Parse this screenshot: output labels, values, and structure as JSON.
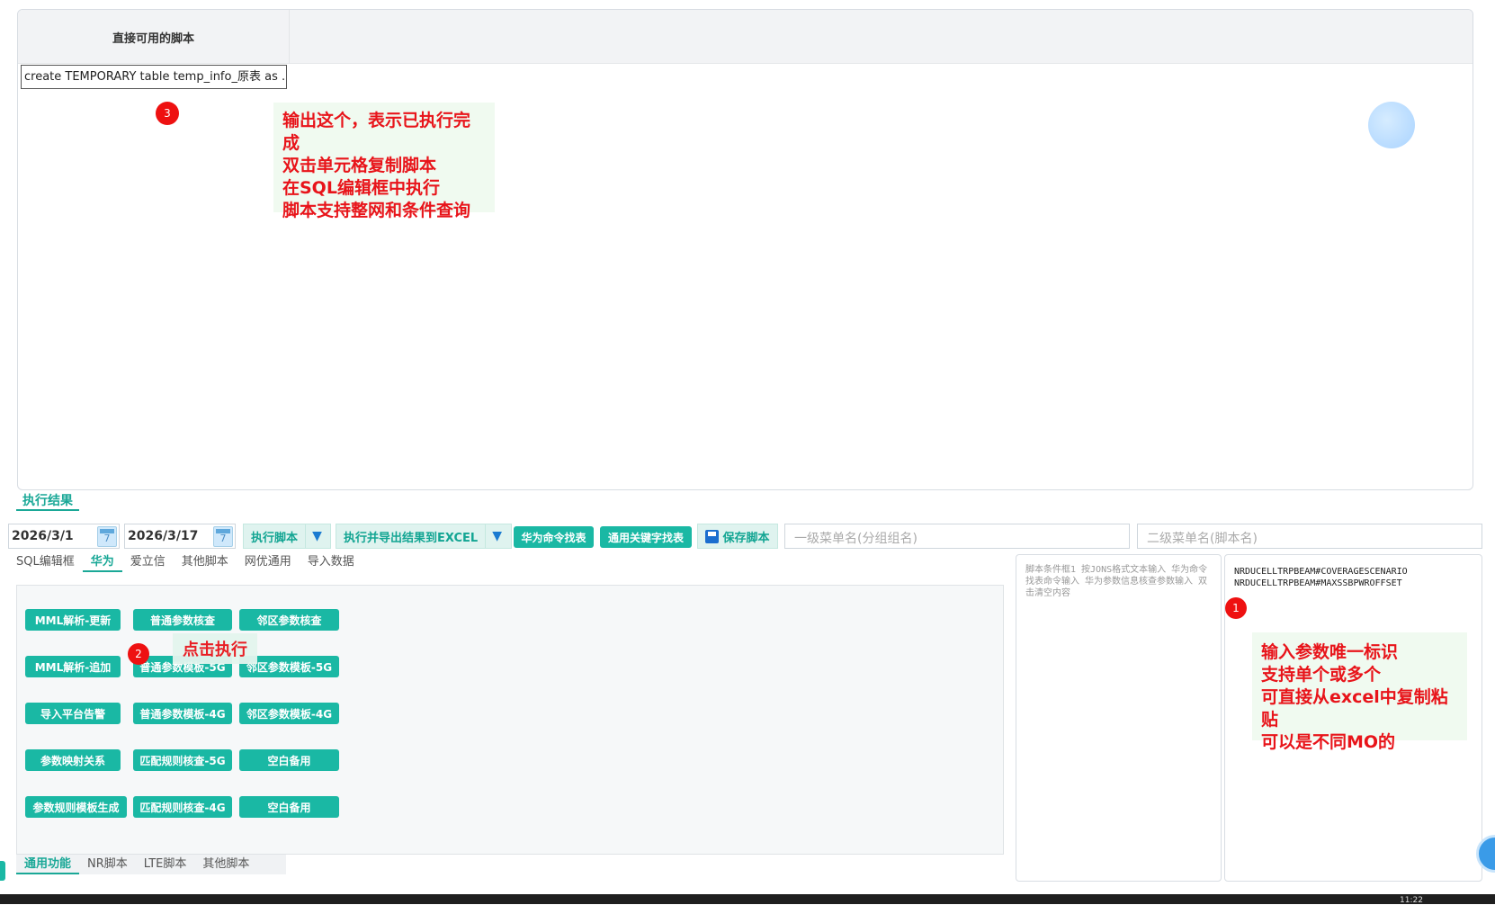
{
  "result_grid": {
    "column_header": "直接可用的脚本",
    "cell_value": "create TEMPORARY table temp_info_原表 as  ..."
  },
  "badges": {
    "one": "1",
    "two": "2",
    "three": "3"
  },
  "note_top": {
    "lines": [
      "输出这个，表示已执行完成",
      "双击单元格复制脚本",
      "在SQL编辑框中执行",
      "脚本支持整网和条件查询"
    ]
  },
  "result_tab": "执行结果",
  "toolbar": {
    "date_start": "2026/3/1",
    "date_end": "2026/3/17",
    "calendar_day": "7",
    "run_script": "执行脚本",
    "run_export": "执行并导出结果到EXCEL",
    "hw_cmd_find": "华为命令找表",
    "kw_find": "通用关键字找表",
    "save_script": "保存脚本",
    "menu1_placeholder": "一级菜单名(分组组名)",
    "menu2_placeholder": "二级菜单名(脚本名)"
  },
  "main_tabs": [
    "SQL编辑框",
    "华为",
    "爱立信",
    "其他脚本",
    "网优通用",
    "导入数据"
  ],
  "active_main_tab": "华为",
  "buttons": {
    "col1": [
      "MML解析-更新",
      "MML解析-追加",
      "导入平台告警",
      "参数映射关系",
      "参数规则模板生成"
    ],
    "col2": [
      "普通参数核查",
      "普通参数模板-5G",
      "普通参数模板-4G",
      "匹配规则核查-5G",
      "匹配规则核查-4G"
    ],
    "col3": [
      "邻区参数核查",
      "邻区参数模板-5G",
      "邻区参数模板-4G",
      "空白备用",
      "空白备用"
    ]
  },
  "note_click": "点击执行",
  "bottom_tabs": [
    "通用功能",
    "NR脚本",
    "LTE脚本",
    "其他脚本"
  ],
  "active_bottom_tab": "通用功能",
  "condition_box": {
    "placeholder": "脚本条件框1  按JONS格式文本输入  华为命令找表命令输入 华为参数信息核查参数输入  双击清空内容"
  },
  "param_box": {
    "lines": [
      "NRDUCELLTRPBEAM#COVERAGESCENARIO",
      "NRDUCELLTRPBEAM#MAXSSBPWROFFSET"
    ]
  },
  "note_param": {
    "lines": [
      "输入参数唯一标识",
      "支持单个或多个",
      "可直接从excel中复制粘贴",
      "可以是不同MO的"
    ]
  },
  "taskbar_clock": "11:22",
  "colors": {
    "accent": "#1ab8a4",
    "annotation_red": "#e8141a",
    "badge_red": "#ee1111"
  }
}
